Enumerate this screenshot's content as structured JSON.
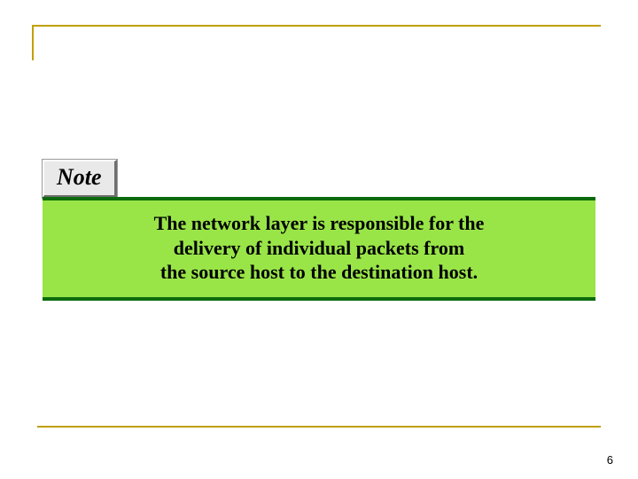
{
  "note": {
    "badge_label": "Note",
    "body_line1": "The network layer is responsible for the",
    "body_line2": "delivery of individual packets from",
    "body_line3": "the source host to the destination host."
  },
  "page": {
    "number": "6"
  },
  "colors": {
    "accent_rule": "#c0a000",
    "note_bg": "#99e548",
    "note_border": "#0b6b0b"
  }
}
